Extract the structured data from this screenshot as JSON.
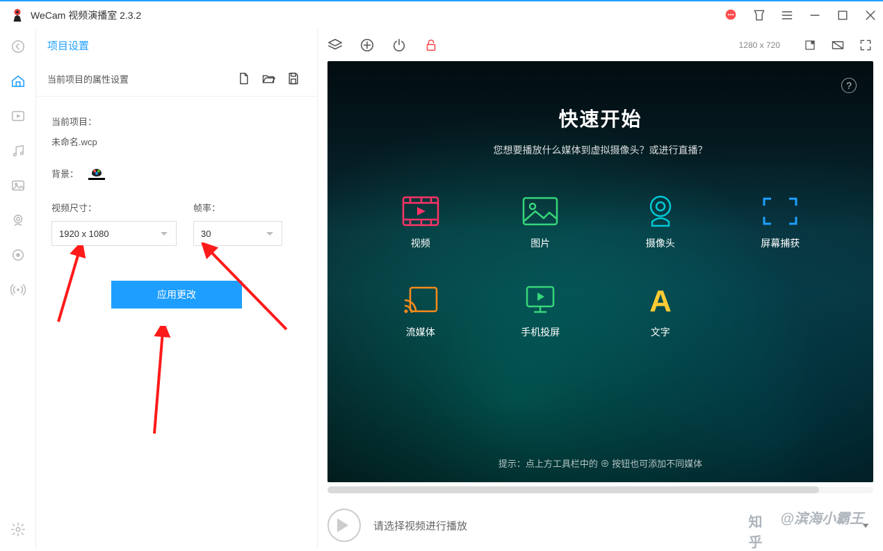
{
  "window": {
    "title": "WeCam 视频演播室 2.3.2"
  },
  "panel": {
    "header": "项目设置",
    "subtitle": "当前项目的属性设置",
    "current_project_label": "当前项目：",
    "project_filename": "未命名.wcp",
    "background_label": "背景：",
    "video_size_label": "视频尺寸：",
    "video_size_value": "1920 x 1080",
    "fps_label": "帧率：",
    "fps_value": "30",
    "apply_button": "应用更改"
  },
  "toolbar": {
    "resolution": "1280 x 720"
  },
  "preview": {
    "title": "快速开始",
    "subtitle": "您想要播放什么媒体到虚拟摄像头？或进行直播？",
    "items": {
      "video": "视频",
      "image": "图片",
      "camera": "摄像头",
      "screen": "屏幕捕获",
      "stream": "流媒体",
      "mobile": "手机投屏",
      "text": "文字"
    },
    "hint": "提示：点上方工具栏中的 ⊕ 按钮也可添加不同媒体"
  },
  "player": {
    "placeholder": "请选择视频进行播放"
  },
  "watermark": {
    "site": "知乎",
    "author": "@滨海小霸王"
  }
}
